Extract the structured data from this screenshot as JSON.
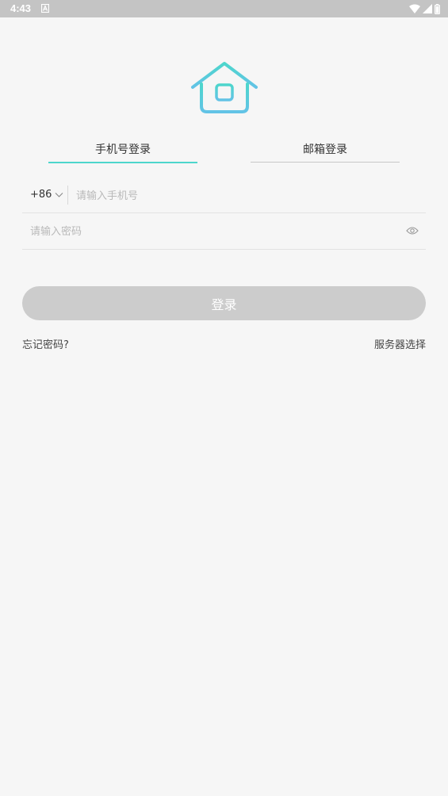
{
  "status_bar": {
    "time": "4:43",
    "icons": [
      "a-notification-icon",
      "wifi-icon",
      "signal-icon",
      "battery-icon"
    ],
    "background": "#c4c4c4"
  },
  "logo": {
    "icon": "house-icon",
    "colors": [
      "#4dd6cc",
      "#62c3e6"
    ]
  },
  "tabs": [
    {
      "label": "手机号登录",
      "active": true
    },
    {
      "label": "邮箱登录",
      "active": false
    }
  ],
  "accent_color": "#4dd6cc",
  "phone_field": {
    "country_code": "+86",
    "placeholder": "请输入手机号",
    "value": ""
  },
  "password_field": {
    "placeholder": "请输入密码",
    "value": ""
  },
  "login_button": {
    "label": "登录",
    "color": "#cccccc"
  },
  "links": {
    "forgot_password": "忘记密码?",
    "server_select": "服务器选择"
  }
}
